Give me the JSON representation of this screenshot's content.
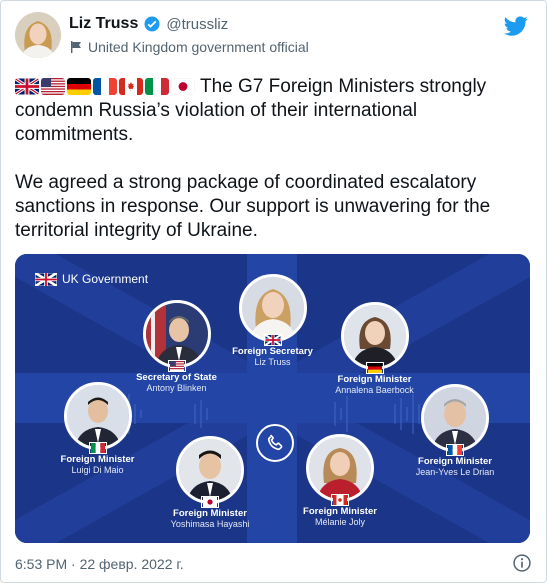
{
  "author": {
    "name": "Liz Truss",
    "handle": "@trussliz",
    "affiliation": "United Kingdom government official"
  },
  "tweet": {
    "flags": [
      "flag-uk",
      "flag-us",
      "flag-de",
      "flag-fr",
      "flag-ca",
      "flag-it",
      "flag-jp"
    ],
    "paragraph1": "The G7 Foreign Ministers strongly condemn Russia’s violation of their international commitments.",
    "paragraph2": "We agreed a strong package of coordinated escalatory sanctions in response. Our support is unwavering for the territorial integrity of Ukraine."
  },
  "media": {
    "brand": "UK Government",
    "people": [
      {
        "role": "Foreign Secretary",
        "name": "Liz Truss",
        "flag": "uk"
      },
      {
        "role": "Secretary of State",
        "name": "Antony Blinken",
        "flag": "us"
      },
      {
        "role": "Foreign Minister",
        "name": "Annalena Baerbock",
        "flag": "de"
      },
      {
        "role": "Foreign Minister",
        "name": "Luigi Di Maio",
        "flag": "it"
      },
      {
        "role": "Foreign Minister",
        "name": "Jean-Yves Le Drian",
        "flag": "fr"
      },
      {
        "role": "Foreign Minister",
        "name": "Yoshimasa Hayashi",
        "flag": "jp"
      },
      {
        "role": "Foreign Minister",
        "name": "Mélanie Joly",
        "flag": "ca"
      }
    ]
  },
  "footer": {
    "timestamp": "6:53 PM · 22 февр. 2022 г."
  },
  "colors": {
    "twitter_blue": "#1d9bf0",
    "media_blue": "#1d3a8f",
    "text_secondary": "#536471"
  },
  "icons": [
    "verified-badge-icon",
    "twitter-bird-icon",
    "government-flag-icon",
    "phone-icon",
    "info-icon"
  ]
}
